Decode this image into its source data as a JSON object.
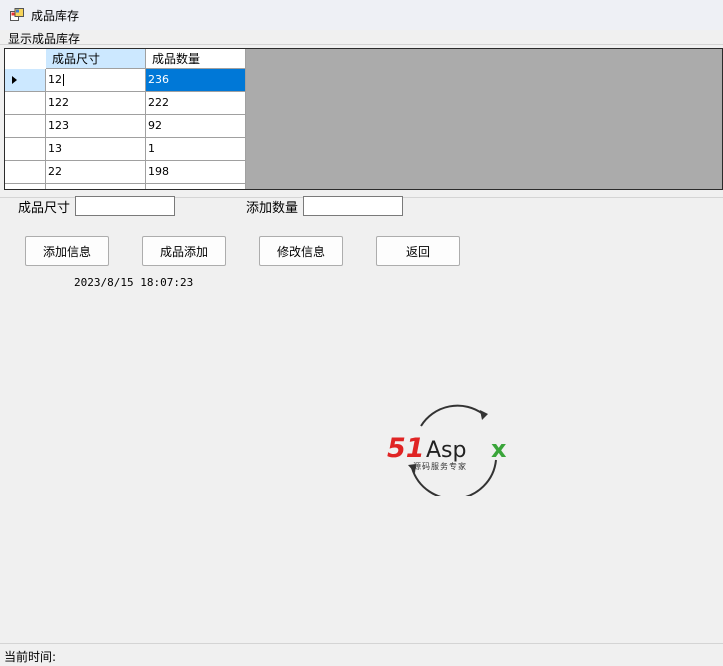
{
  "window": {
    "title": "成品库存"
  },
  "group": {
    "label": "显示成品库存"
  },
  "grid": {
    "columns": [
      "成品尺寸",
      "成品数量"
    ],
    "rows": [
      {
        "size": "12",
        "qty": "236",
        "selected": true
      },
      {
        "size": "122",
        "qty": "222"
      },
      {
        "size": "123",
        "qty": "92"
      },
      {
        "size": "13",
        "qty": "1"
      },
      {
        "size": "22",
        "qty": "198"
      }
    ]
  },
  "form": {
    "size_label": "成品尺寸",
    "size_value": "",
    "qty_label": "添加数量",
    "qty_value": ""
  },
  "buttons": {
    "add_info": "添加信息",
    "product_add": "成品添加",
    "modify_info": "修改信息",
    "back": "返回"
  },
  "timestamp": "2023/8/15 18:07:23",
  "logo": {
    "brand": "51Aspx",
    "tagline": "源码服务专家"
  },
  "status": {
    "label": "当前时间:"
  },
  "colors": {
    "selection": "#0078d7",
    "header_highlight": "#cce8ff",
    "grid_background": "#ababab",
    "logo_red": "#e02424",
    "logo_green": "#3aa53a"
  }
}
